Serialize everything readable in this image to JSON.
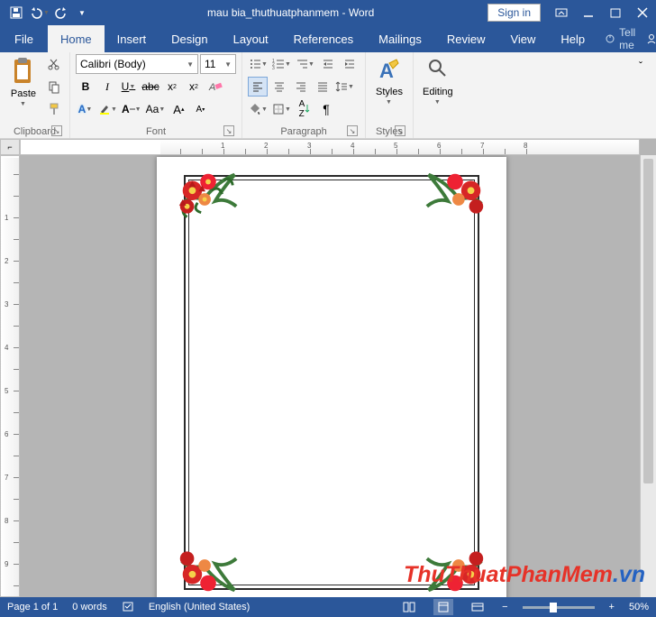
{
  "title": {
    "doc": "mau bia_thuthuatphanmem",
    "app": "Word"
  },
  "signin": "Sign in",
  "tabs": {
    "file": "File",
    "home": "Home",
    "insert": "Insert",
    "design": "Design",
    "layout": "Layout",
    "references": "References",
    "mailings": "Mailings",
    "review": "Review",
    "view": "View",
    "help": "Help"
  },
  "tellme": "Tell me",
  "share": "Share",
  "ribbon": {
    "clipboard": {
      "label": "Clipboard",
      "paste": "Paste"
    },
    "font": {
      "label": "Font",
      "family": "Calibri (Body)",
      "size": "11"
    },
    "paragraph": {
      "label": "Paragraph"
    },
    "styles": {
      "label": "Styles",
      "btn": "Styles"
    },
    "editing": {
      "label": "Editing",
      "btn": "Editing"
    }
  },
  "ruler_corner": "⌐",
  "status": {
    "page": "Page 1 of 1",
    "words": "0 words",
    "lang": "English (United States)",
    "zoom": "50%"
  },
  "watermark": {
    "a": "ThuThuatPhanMem",
    "b": ".vn"
  }
}
